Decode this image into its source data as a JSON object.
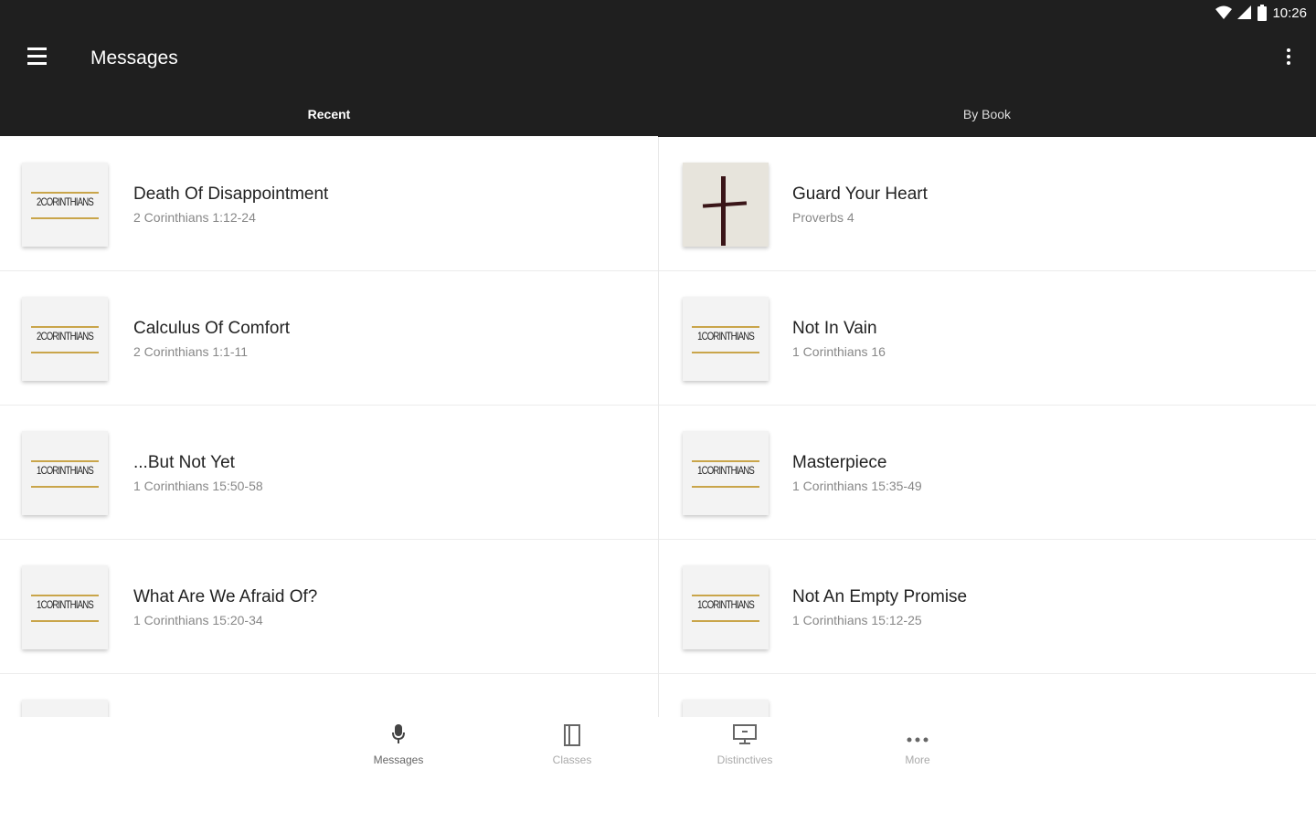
{
  "status_bar": {
    "time": "10:26",
    "wifi_icon": "wifi-icon",
    "signal_icon": "signal-icon",
    "battery_icon": "battery-icon"
  },
  "app_bar": {
    "title": "Messages",
    "menu_icon": "menu-icon",
    "overflow_icon": "more-vert-icon"
  },
  "tabs": [
    {
      "label": "Recent",
      "active": true
    },
    {
      "label": "By Book",
      "active": false
    }
  ],
  "messages_left": [
    {
      "title": "Death Of Disappointment",
      "reference": "2 Corinthians 1:12-24",
      "thumb_label": "2CORINTHIANS"
    },
    {
      "title": "Calculus Of Comfort",
      "reference": "2 Corinthians 1:1-11",
      "thumb_label": "2CORINTHIANS"
    },
    {
      "title": "...But Not Yet",
      "reference": "1 Corinthians 15:50-58",
      "thumb_label": "1CORINTHIANS"
    },
    {
      "title": "What Are We Afraid Of?",
      "reference": "1 Corinthians 15:20-34",
      "thumb_label": "1CORINTHIANS"
    }
  ],
  "messages_right": [
    {
      "title": "Guard Your Heart",
      "reference": "Proverbs 4",
      "thumb_label": ""
    },
    {
      "title": "Not In Vain",
      "reference": "1 Corinthians 16",
      "thumb_label": "1CORINTHIANS"
    },
    {
      "title": "Masterpiece",
      "reference": "1 Corinthians 15:35-49",
      "thumb_label": "1CORINTHIANS"
    },
    {
      "title": "Not An Empty Promise",
      "reference": "1 Corinthians 15:12-25",
      "thumb_label": "1CORINTHIANS"
    }
  ],
  "bottom_nav": [
    {
      "label": "Messages",
      "icon": "microphone-icon",
      "active": true
    },
    {
      "label": "Classes",
      "icon": "book-icon",
      "active": false
    },
    {
      "label": "Distinctives",
      "icon": "presentation-icon",
      "active": false
    },
    {
      "label": "More",
      "icon": "more-horiz-icon",
      "active": false
    }
  ]
}
